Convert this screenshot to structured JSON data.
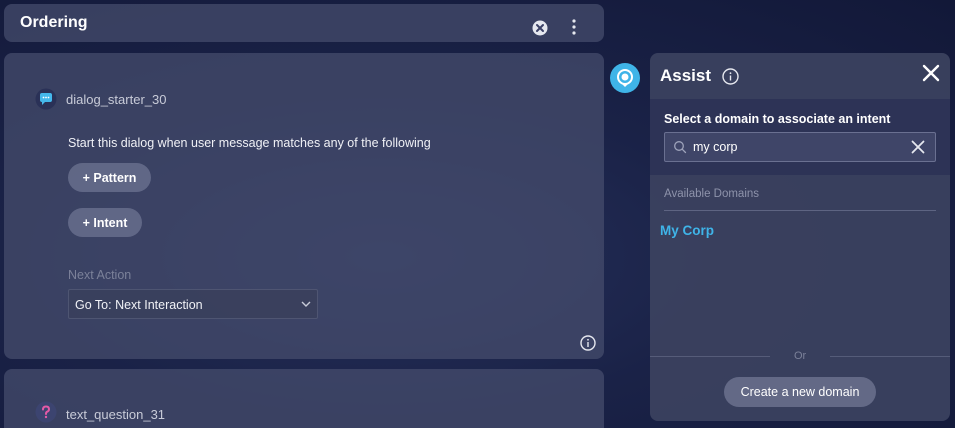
{
  "header": {
    "title": "Ordering",
    "icons": {
      "close": "circle-x-icon",
      "more": "more-vertical-icon"
    }
  },
  "dialog_card": {
    "name": "dialog_starter_30",
    "icon": "chat-bubble-icon",
    "description": "Start this dialog when user message matches any of the following",
    "pattern_button": "+ Pattern",
    "intent_button": "+ Intent",
    "next_action_label": "Next Action",
    "next_action_value": "Go To: Next Interaction",
    "info_icon": "info-icon"
  },
  "second_card": {
    "name": "text_question_31",
    "icon": "question-icon"
  },
  "assist": {
    "title": "Assist",
    "prompt": "Select a domain to associate an intent",
    "search_value": "my corp",
    "available_label": "Available Domains",
    "domains": [
      "My Corp"
    ],
    "or_text": "Or",
    "create_button": "Create a new domain"
  },
  "colors": {
    "accent": "#3fb4e8",
    "background": "#1a2247"
  }
}
